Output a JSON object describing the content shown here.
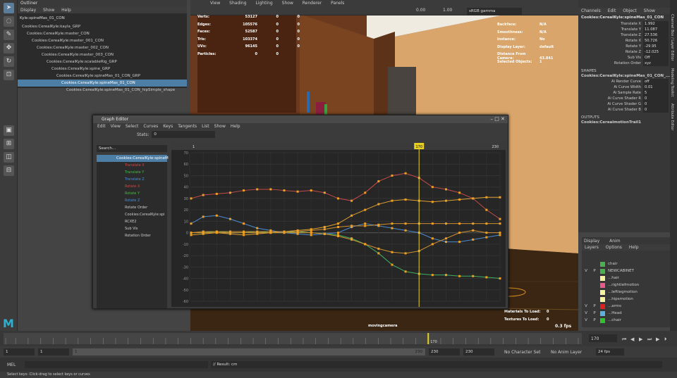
{
  "left_toolbar": {
    "icons": [
      "select-tool-icon",
      "lasso-tool-icon",
      "paint-tool-icon",
      "move-tool-icon",
      "rotate-tool-icon",
      "scale-tool-icon",
      "single-view-icon",
      "four-view-icon",
      "two-view-icon",
      "three-view-icon"
    ]
  },
  "outliner": {
    "title": "Outliner",
    "menu": [
      "Display",
      "Show",
      "Help"
    ],
    "search": "Kyle:spineMas_01_CON",
    "items": [
      {
        "label": "Cookies:CerealKyle:kayla_GRP",
        "depth": 0,
        "selected": false
      },
      {
        "label": "Cookies:CerealKyle:master_CON",
        "depth": 1,
        "selected": false
      },
      {
        "label": "Cookies:CerealKyle:master_001_CON",
        "depth": 2,
        "selected": false
      },
      {
        "label": "Cookies:CerealKyle:master_002_CON",
        "depth": 3,
        "selected": false
      },
      {
        "label": "Cookies:CerealKyle:master_003_CON",
        "depth": 4,
        "selected": false
      },
      {
        "label": "Cookies:CerealKyle:scalableRig_GRP",
        "depth": 5,
        "selected": false
      },
      {
        "label": "Cookies:CerealKyle:spine_GRP",
        "depth": 6,
        "selected": false
      },
      {
        "label": "Cookies:CerealKyle:spineMas_01_CON_GRP",
        "depth": 7,
        "selected": false
      },
      {
        "label": "Cookies:CerealKyle:spineMas_01_CON",
        "depth": 8,
        "selected": true
      },
      {
        "label": "Cookies:CerealKyle:spineMas_01_CON_hipSimple_shape",
        "depth": 9,
        "selected": false
      }
    ]
  },
  "viewport": {
    "menu": [
      "View",
      "Shading",
      "Lighting",
      "Show",
      "Renderer",
      "Panels"
    ],
    "exposure": "0.00",
    "gamma": "1.00",
    "colorspace": "sRGB gamma",
    "stats": [
      {
        "k": "Verts:",
        "a": "53127",
        "b": "0",
        "c": "0"
      },
      {
        "k": "Edges:",
        "a": "105576",
        "b": "0",
        "c": "0"
      },
      {
        "k": "Faces:",
        "a": "52587",
        "b": "0",
        "c": "0"
      },
      {
        "k": "Tris:",
        "a": "103374",
        "b": "0",
        "c": "0"
      },
      {
        "k": "UVs:",
        "a": "96145",
        "b": "0",
        "c": "0"
      },
      {
        "k": "Particles:",
        "a": "0",
        "b": "0",
        "c": ""
      }
    ],
    "info": [
      {
        "k": "Backface:",
        "v": "N/A"
      },
      {
        "k": "Smoothness:",
        "v": "N/A"
      },
      {
        "k": "Instance:",
        "v": "No"
      },
      {
        "k": "Display Layer:",
        "v": "default"
      },
      {
        "k": "Distance From Camera:",
        "v": "43.841"
      },
      {
        "k": "Selected Objects:",
        "v": "1"
      }
    ],
    "bottom_stats": [
      {
        "k": "Materials To Load:",
        "v": "0"
      },
      {
        "k": "Textures To Load:",
        "v": "0"
      }
    ],
    "camera": "movingcamera",
    "fps": "0.3 fps"
  },
  "channel_box": {
    "menu": [
      "Channels",
      "Edit",
      "Object",
      "Show"
    ],
    "object": "Cookies:CerealKyle:spineMas_01_CON",
    "attrs": [
      {
        "n": "Translate X",
        "v": "1.992"
      },
      {
        "n": "Translate Y",
        "v": "11.087"
      },
      {
        "n": "Translate Z",
        "v": "27.536"
      },
      {
        "n": "Rotate X",
        "v": "50.726"
      },
      {
        "n": "Rotate Y",
        "v": "-29.95"
      },
      {
        "n": "Rotate Z",
        "v": "-12.025"
      },
      {
        "n": "Sub Vis",
        "v": "Off"
      },
      {
        "n": "Rotation Order",
        "v": "xyz"
      }
    ],
    "shapes_header": "SHAPES",
    "shape": "Cookies:CerealKyle:spineMas_01_CON_...",
    "shape_attrs": [
      {
        "n": "Ai Render Curve",
        "v": "off"
      },
      {
        "n": "Ai Curve Width",
        "v": "0.01"
      },
      {
        "n": "Ai Sample Rate",
        "v": "5"
      },
      {
        "n": "Ai Curve Shader R",
        "v": "0"
      },
      {
        "n": "Ai Curve Shader G",
        "v": "0"
      },
      {
        "n": "Ai Curve Shader B",
        "v": "0"
      }
    ],
    "outputs_header": "OUTPUTS",
    "output": "Cookies:CerealmotionTrail1"
  },
  "side_tabs": [
    "Channel Box / Layer Editor",
    "Modeling Toolkit",
    "Attribute Editor"
  ],
  "layers": {
    "tabs": [
      "Display",
      "Anim"
    ],
    "menu": [
      "Layers",
      "Options",
      "Help"
    ],
    "items": [
      {
        "v": "",
        "p": "",
        "color": "#4caf50",
        "name": "chair"
      },
      {
        "v": "V",
        "p": "P",
        "color": "#4caf50",
        "name": "NEWCABINET"
      },
      {
        "v": "",
        "p": "",
        "color": "#f5f3a0",
        "name": "...hair"
      },
      {
        "v": "",
        "p": "",
        "color": "#e85a8a",
        "name": "...rightlefmotion"
      },
      {
        "v": "",
        "p": "",
        "color": "#f5f3a0",
        "name": "...leftlegmotion"
      },
      {
        "v": "",
        "p": "",
        "color": "#f5f3a0",
        "name": "...hipsmotion"
      },
      {
        "v": "V",
        "p": "P",
        "color": "#e02020",
        "name": "...arms"
      },
      {
        "v": "V",
        "p": "P",
        "color": "#5fb0e0",
        "name": "...Head"
      },
      {
        "v": "V",
        "p": "P",
        "color": "#30c030",
        "name": "...chair"
      }
    ]
  },
  "graph_editor": {
    "title": "Graph Editor",
    "menu": [
      "Edit",
      "View",
      "Select",
      "Curves",
      "Keys",
      "Tangents",
      "List",
      "Show",
      "Help"
    ],
    "stats_label": "Stats:",
    "stats_value": "0",
    "search_placeholder": "Search...",
    "top_item": "Cookies:CerealKyle:spineM",
    "curves": [
      {
        "name": "Translate X",
        "color": "#e04040"
      },
      {
        "name": "Translate Y",
        "color": "#40c040"
      },
      {
        "name": "Translate Z",
        "color": "#4090e0"
      },
      {
        "name": "Rotate X",
        "color": "#e04040"
      },
      {
        "name": "Rotate Y",
        "color": "#40c040"
      },
      {
        "name": "Rotate Z",
        "color": "#4090e0"
      },
      {
        "name": "Rotate Order",
        "color": "#cccccc"
      },
      {
        "name": "Cookies:CerealKyle:spi",
        "color": "#cccccc"
      },
      {
        "name": "RCXE2",
        "color": "#cccccc"
      },
      {
        "name": "Sub Vis",
        "color": "#cccccc"
      },
      {
        "name": "Rotation Order",
        "color": "#cccccc"
      }
    ],
    "x_ticks": [
      "1",
      "230"
    ],
    "current_frame": "170",
    "end_frame": "230",
    "y_ticks": [
      "70",
      "60",
      "50",
      "40",
      "30",
      "20",
      "10",
      "0",
      "-10",
      "-20",
      "-30",
      "-40",
      "-50",
      "-60"
    ]
  },
  "timeline": {
    "current": "170",
    "ticks": [
      "1",
      "5",
      "10",
      "15",
      "20",
      "25",
      "30",
      "35",
      "40",
      "45",
      "50",
      "55",
      "60",
      "65",
      "70",
      "75",
      "80",
      "85",
      "90",
      "95",
      "100",
      "105",
      "110",
      "115",
      "120",
      "125",
      "130",
      "135",
      "140",
      "145",
      "150",
      "155",
      "160",
      "165",
      "170",
      "175",
      "180",
      "185",
      "190",
      "195",
      "200",
      "205",
      "210",
      "215",
      "220",
      "225",
      "230"
    ]
  },
  "range": {
    "start": "1",
    "start2": "1",
    "range_start": "1",
    "range_end": "230",
    "end": "230",
    "end2": "230",
    "character_set": "No Character Set",
    "anim_layer": "No Anim Layer",
    "fps": "24 fps"
  },
  "command": {
    "lang": "MEL",
    "result": "// Result: cm"
  },
  "help_line": "Select keys: Click-drag to select keys or curves",
  "chart_data": {
    "type": "line",
    "title": "",
    "xlabel": "",
    "ylabel": "",
    "xlim": [
      1,
      230
    ],
    "ylim": [
      -60,
      70
    ],
    "x": [
      1,
      10,
      20,
      30,
      40,
      50,
      60,
      70,
      80,
      90,
      100,
      110,
      120,
      130,
      140,
      150,
      160,
      170,
      180,
      190,
      200,
      210,
      220,
      230
    ],
    "series": [
      {
        "color": "#c94a4a",
        "values": [
          30,
          33,
          34,
          35,
          37,
          38,
          38,
          37,
          36,
          37,
          35,
          30,
          28,
          35,
          45,
          50,
          52,
          48,
          40,
          38,
          35,
          30,
          20,
          12
        ]
      },
      {
        "color": "#e0a030",
        "values": [
          -2,
          -1,
          0,
          -1,
          -2,
          -1,
          0,
          1,
          2,
          3,
          5,
          8,
          15,
          20,
          25,
          28,
          29,
          28,
          27,
          28,
          29,
          30,
          31,
          31
        ]
      },
      {
        "color": "#4a8ad0",
        "values": [
          8,
          14,
          15,
          12,
          8,
          4,
          2,
          0,
          -1,
          -2,
          -1,
          0,
          5,
          8,
          6,
          4,
          2,
          0,
          -5,
          -8,
          -8,
          -6,
          -4,
          -2
        ]
      },
      {
        "color": "#40b060",
        "values": [
          0,
          0,
          1,
          0,
          0,
          1,
          0,
          0,
          1,
          0,
          -1,
          -2,
          -5,
          -10,
          -18,
          -28,
          -34,
          -36,
          -37,
          -37,
          -38,
          -38,
          -39,
          -40
        ]
      },
      {
        "color": "#d09030",
        "values": [
          0,
          0,
          0,
          0,
          0,
          0,
          0,
          0,
          0,
          0,
          -1,
          -3,
          -6,
          -10,
          -14,
          -17,
          -18,
          -16,
          -10,
          -5,
          0,
          2,
          0,
          0
        ]
      },
      {
        "color": "#d09030",
        "values": [
          0,
          1,
          1,
          1,
          1,
          1,
          1,
          1,
          1,
          2,
          3,
          5,
          6,
          6,
          7,
          8,
          8,
          8,
          8,
          8,
          8,
          8,
          8,
          8
        ]
      }
    ]
  }
}
